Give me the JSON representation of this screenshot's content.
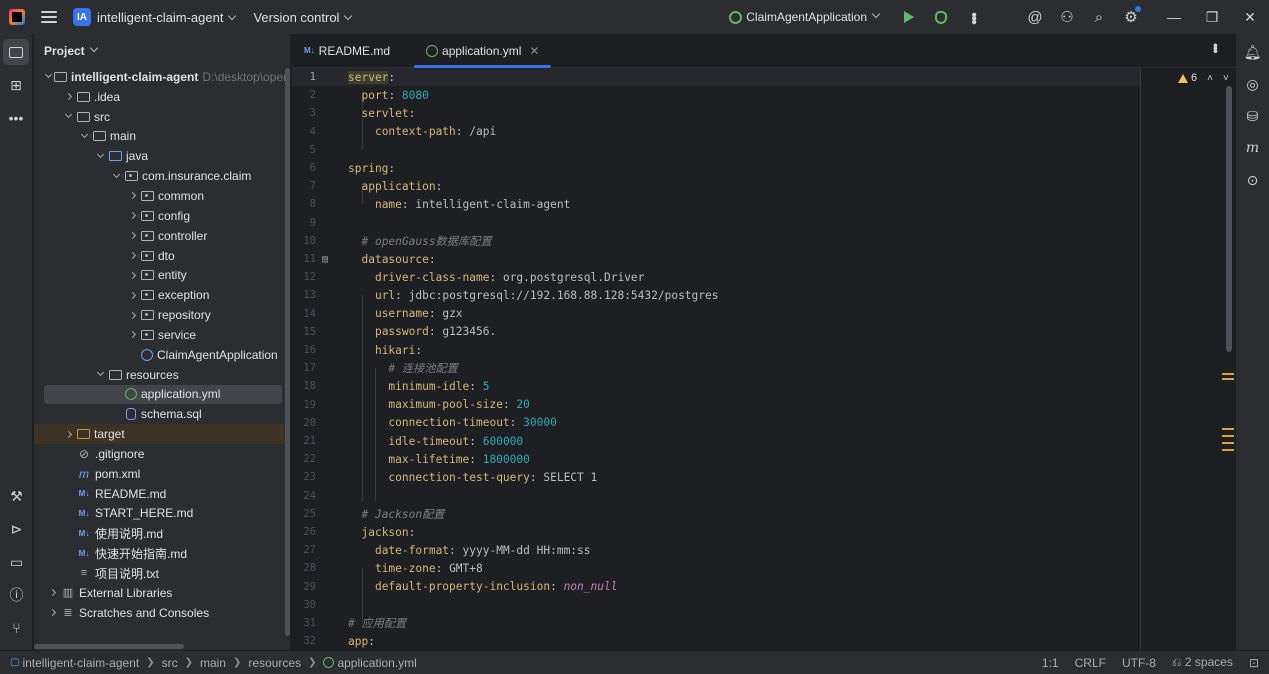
{
  "titlebar": {
    "project_badge": "IA",
    "project_name": "intelligent-claim-agent",
    "vcs_label": "Version control",
    "run_config": "ClaimAgentApplication"
  },
  "project_panel": {
    "title": "Project",
    "root_name": "intelligent-claim-agent",
    "root_path": "D:\\desktop\\opengauss",
    "items": {
      "idea": ".idea",
      "src": "src",
      "main": "main",
      "java": "java",
      "pkg": "com.insurance.claim",
      "common": "common",
      "config": "config",
      "controller": "controller",
      "dto": "dto",
      "entity": "entity",
      "exception": "exception",
      "repository": "repository",
      "service": "service",
      "app": "ClaimAgentApplication",
      "resources": "resources",
      "application_yml": "application.yml",
      "schema_sql": "schema.sql",
      "target": "target",
      "gitignore": ".gitignore",
      "pom": "pom.xml",
      "readme": "README.md",
      "start_here": "START_HERE.md",
      "usage": "使用说明.md",
      "quickstart": "快速开始指南.md",
      "project_desc": "项目说明.txt",
      "ext_libs": "External Libraries",
      "scratches": "Scratches and Consoles"
    }
  },
  "tabs": [
    {
      "label": "README.md",
      "badge": "M↓"
    },
    {
      "label": "application.yml"
    }
  ],
  "editor": {
    "warning_count": "6",
    "code": {
      "l1": "server",
      "l2k": "port",
      "l2v": "8080",
      "l3": "servlet",
      "l4k": "context-path",
      "l4v": "/api",
      "l6": "spring",
      "l7": "application",
      "l8k": "name",
      "l8v": "intelligent-claim-agent",
      "l10": "# openGauss数据库配置",
      "l11": "datasource",
      "l12k": "driver-class-name",
      "l12v": "org.postgresql.Driver",
      "l13k": "url",
      "l13v": "jdbc:postgresql://192.168.88.128:5432/postgres",
      "l14k": "username",
      "l14v": "gzx",
      "l15k": "password",
      "l15v": "g123456.",
      "l16": "hikari",
      "l17": "# 连接池配置",
      "l18k": "minimum-idle",
      "l18v": "5",
      "l19k": "maximum-pool-size",
      "l19v": "20",
      "l20k": "connection-timeout",
      "l20v": "30000",
      "l21k": "idle-timeout",
      "l21v": "600000",
      "l22k": "max-lifetime",
      "l22v": "1800000",
      "l23k": "connection-test-query",
      "l23v": "SELECT 1",
      "l25": "# Jackson配置",
      "l26": "jackson",
      "l27k": "date-format",
      "l27v": "yyyy-MM-dd HH:mm:ss",
      "l28k": "time-zone",
      "l28v": "GMT+8",
      "l29k": "default-property-inclusion",
      "l29v": "non_null",
      "l31": "# 应用配置",
      "l32": "app"
    }
  },
  "statusbar": {
    "crumbs": [
      "intelligent-claim-agent",
      "src",
      "main",
      "resources",
      "application.yml"
    ],
    "position": "1:1",
    "line_sep": "CRLF",
    "encoding": "UTF-8",
    "indent": "2 spaces"
  },
  "colors": {
    "accent": "#3574f0",
    "key": "#d5b778",
    "number": "#2aacb8",
    "comment": "#7a7e85"
  }
}
